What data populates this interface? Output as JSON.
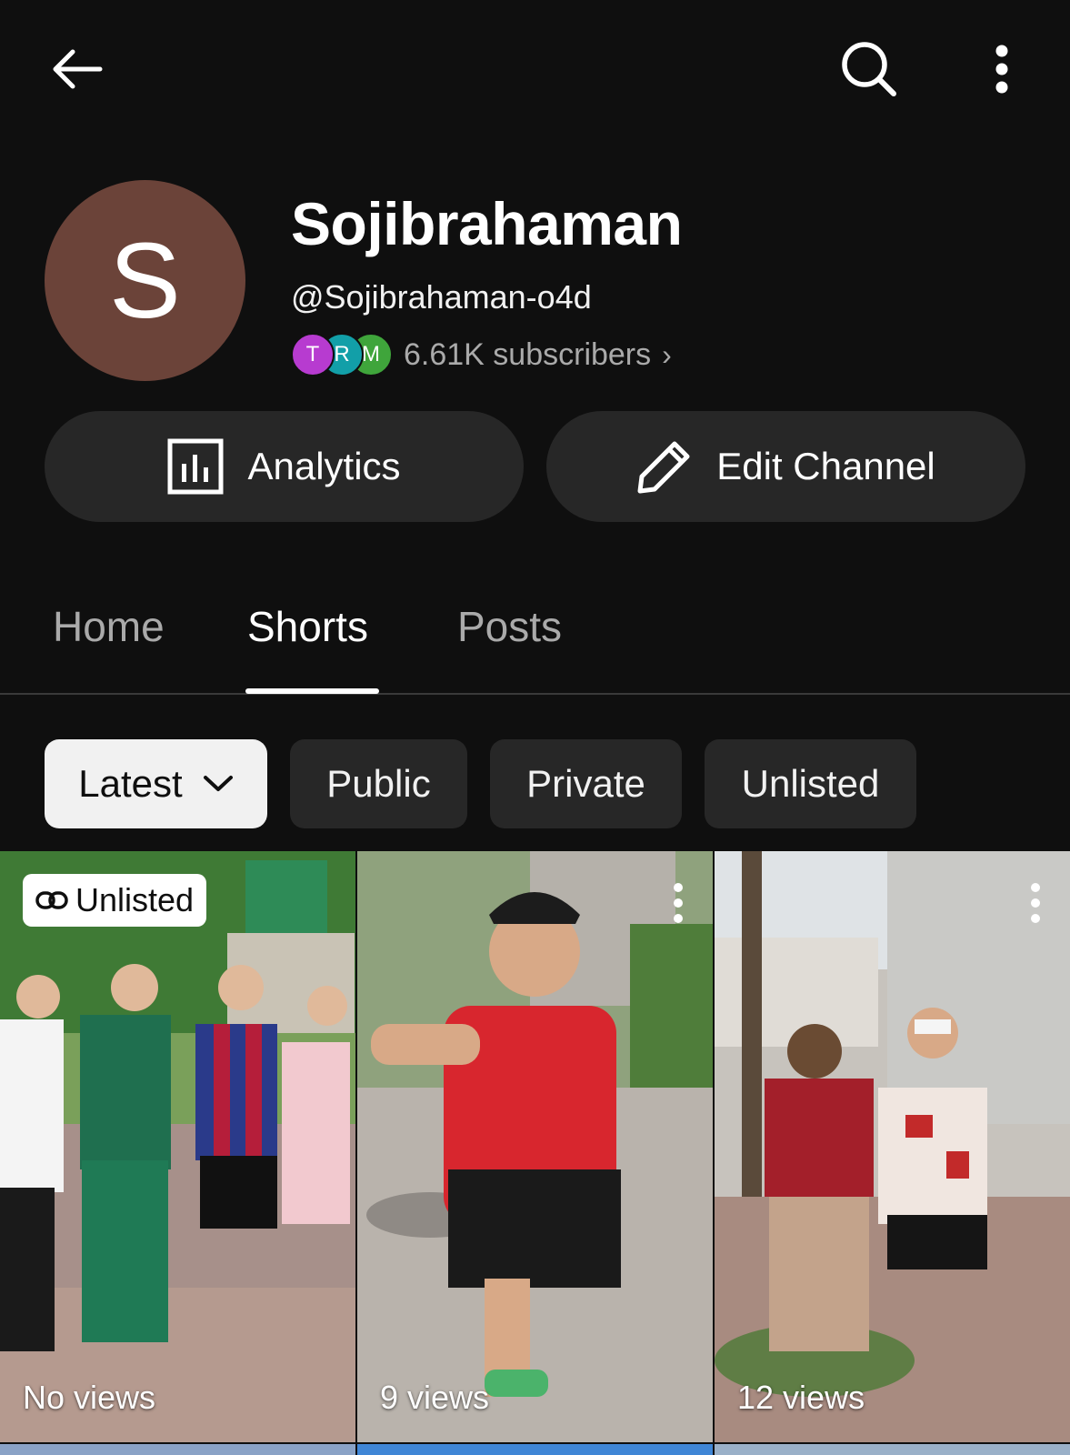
{
  "topbar": {
    "back_icon": "arrow-left-icon",
    "search_icon": "search-icon",
    "more_icon": "more-vertical-icon"
  },
  "channel": {
    "avatar_letter": "S",
    "avatar_color": "#6b4339",
    "name": "Sojibrahaman",
    "handle": "@Sojibrahaman-o4d",
    "subscriber_avatars": [
      "T",
      "R",
      "M"
    ],
    "subscribers": "6.61K subscribers",
    "subscribers_chevron": "›"
  },
  "actions": {
    "analytics_label": "Analytics",
    "analytics_icon": "bar-chart-icon",
    "edit_label": "Edit Channel",
    "edit_icon": "pencil-icon"
  },
  "tabs": [
    {
      "label": "Home",
      "selected": false
    },
    {
      "label": "Shorts",
      "selected": true
    },
    {
      "label": "Posts",
      "selected": false
    }
  ],
  "filters": {
    "sort_label": "Latest",
    "chips": [
      "Public",
      "Private",
      "Unlisted"
    ]
  },
  "shorts": [
    {
      "views": "No views",
      "badge": "Unlisted"
    },
    {
      "views": "9 views"
    },
    {
      "views": "12 views"
    }
  ],
  "colors": {
    "background": "#0f0f0f",
    "button_bg": "#272727",
    "chip_selected_bg": "#f1f1f1",
    "secondary_text": "#aaaaaa"
  }
}
